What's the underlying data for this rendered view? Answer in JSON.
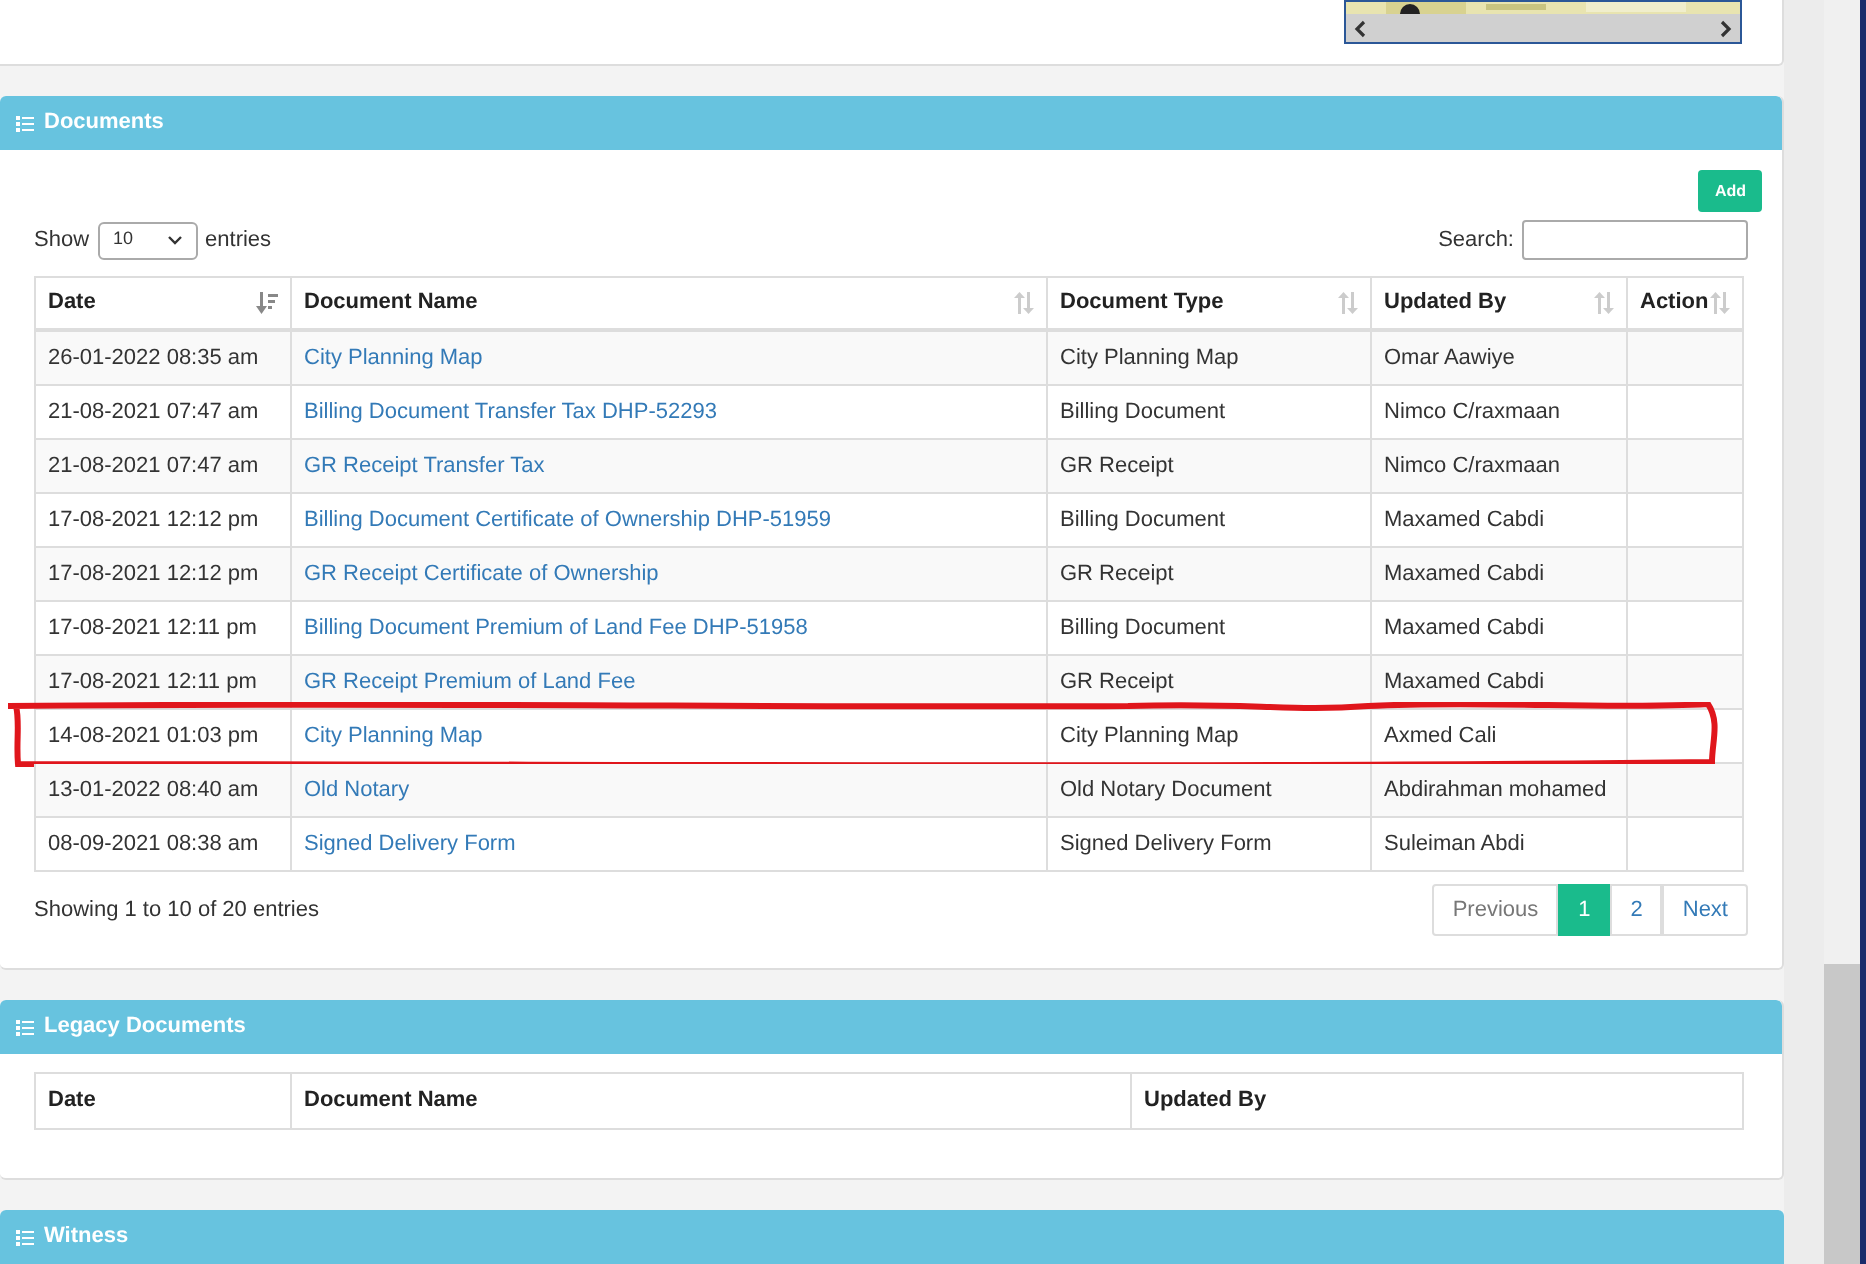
{
  "documents": {
    "title": "Documents",
    "add_button": "Add",
    "show_label": "Show",
    "page_size": "10",
    "entries_label": "entries",
    "search_label": "Search:",
    "columns": [
      {
        "label": "Date",
        "sorted": true
      },
      {
        "label": "Document Name",
        "sorted": false
      },
      {
        "label": "Document Type",
        "sorted": false
      },
      {
        "label": "Updated By",
        "sorted": false
      },
      {
        "label": "Action",
        "sorted": false
      }
    ],
    "rows": [
      {
        "date": "26-01-2022 08:35 am",
        "name": "City Planning Map",
        "type": "City Planning Map",
        "updated_by": "Omar Aawiye",
        "circled": false
      },
      {
        "date": "21-08-2021 07:47 am",
        "name": "Billing Document Transfer Tax DHP-52293",
        "type": "Billing Document",
        "updated_by": "Nimco C/raxmaan",
        "circled": false
      },
      {
        "date": "21-08-2021 07:47 am",
        "name": "GR Receipt Transfer Tax",
        "type": "GR Receipt",
        "updated_by": "Nimco C/raxmaan",
        "circled": false
      },
      {
        "date": "17-08-2021 12:12 pm",
        "name": "Billing Document Certificate of Ownership DHP-51959",
        "type": "Billing Document",
        "updated_by": "Maxamed Cabdi",
        "circled": false
      },
      {
        "date": "17-08-2021 12:12 pm",
        "name": "GR Receipt Certificate of Ownership",
        "type": "GR Receipt",
        "updated_by": "Maxamed Cabdi",
        "circled": false
      },
      {
        "date": "17-08-2021 12:11 pm",
        "name": "Billing Document Premium of Land Fee DHP-51958",
        "type": "Billing Document",
        "updated_by": "Maxamed Cabdi",
        "circled": false
      },
      {
        "date": "17-08-2021 12:11 pm",
        "name": "GR Receipt Premium of Land Fee",
        "type": "GR Receipt",
        "updated_by": "Maxamed Cabdi",
        "circled": false
      },
      {
        "date": "14-08-2021 01:03 pm",
        "name": "City Planning Map",
        "type": "City Planning Map",
        "updated_by": "Axmed Cali",
        "circled": true
      },
      {
        "date": "13-01-2022 08:40 am",
        "name": "Old Notary",
        "type": "Old Notary Document",
        "updated_by": "Abdirahman mohamed",
        "circled": false
      },
      {
        "date": "08-09-2021 08:38 am",
        "name": "Signed Delivery Form",
        "type": "Signed Delivery Form",
        "updated_by": "Suleiman Abdi",
        "circled": false
      }
    ],
    "info": "Showing 1 to 10 of 20 entries",
    "pagination": [
      {
        "label": "Previous",
        "kind": "nav",
        "selected": false
      },
      {
        "label": "1",
        "kind": "page",
        "selected": true
      },
      {
        "label": "2",
        "kind": "page",
        "selected": false
      },
      {
        "label": "Next",
        "kind": "nav",
        "selected": false
      }
    ]
  },
  "legacy_documents": {
    "title": "Legacy Documents",
    "columns": [
      "Date",
      "Document Name",
      "Updated By"
    ]
  },
  "witness": {
    "title": "Witness"
  }
}
